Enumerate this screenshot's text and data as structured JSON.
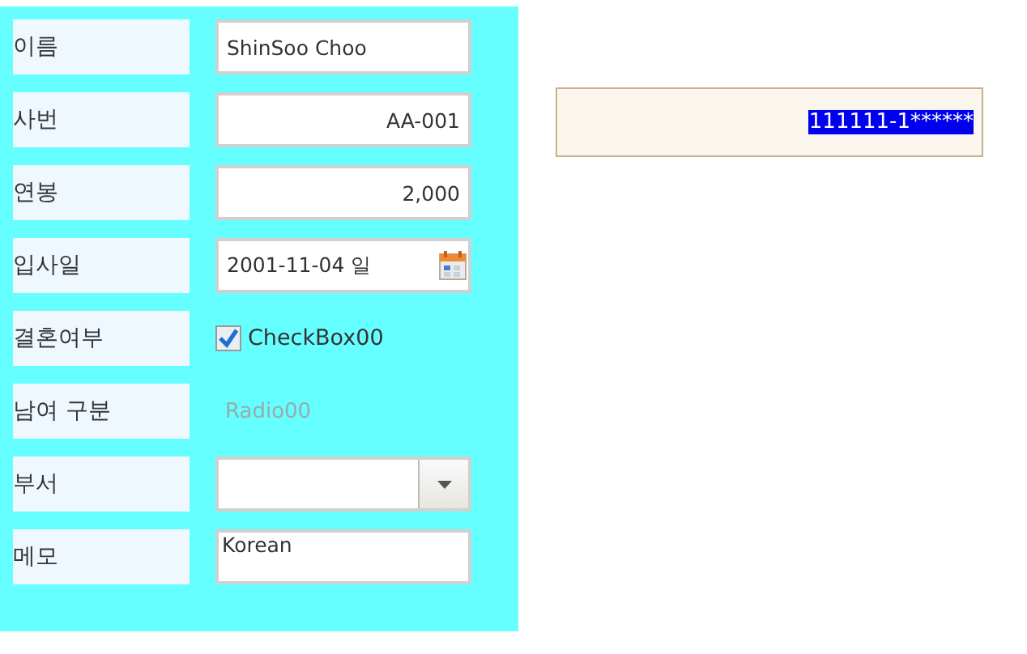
{
  "form": {
    "rows": [
      {
        "label": "이름",
        "kind": "text",
        "value": "ShinSoo Choo",
        "right_aligned": false
      },
      {
        "label": "사번",
        "kind": "text",
        "value": "AA-001",
        "right_aligned": true
      },
      {
        "label": "연봉",
        "kind": "text",
        "value": "2,000",
        "right_aligned": true
      },
      {
        "label": "입사일",
        "kind": "date",
        "value": "2001-11-04 일"
      },
      {
        "label": "결혼여부",
        "kind": "checkbox",
        "value": "CheckBox00",
        "checked": true
      },
      {
        "label": "남여 구분",
        "kind": "radio",
        "value": "Radio00",
        "disabled": true
      },
      {
        "label": "부서",
        "kind": "combo"
      },
      {
        "label": "메모",
        "kind": "memo",
        "value": "Korean"
      }
    ]
  },
  "masked_field": {
    "value": "111111-1******",
    "selected": true
  }
}
